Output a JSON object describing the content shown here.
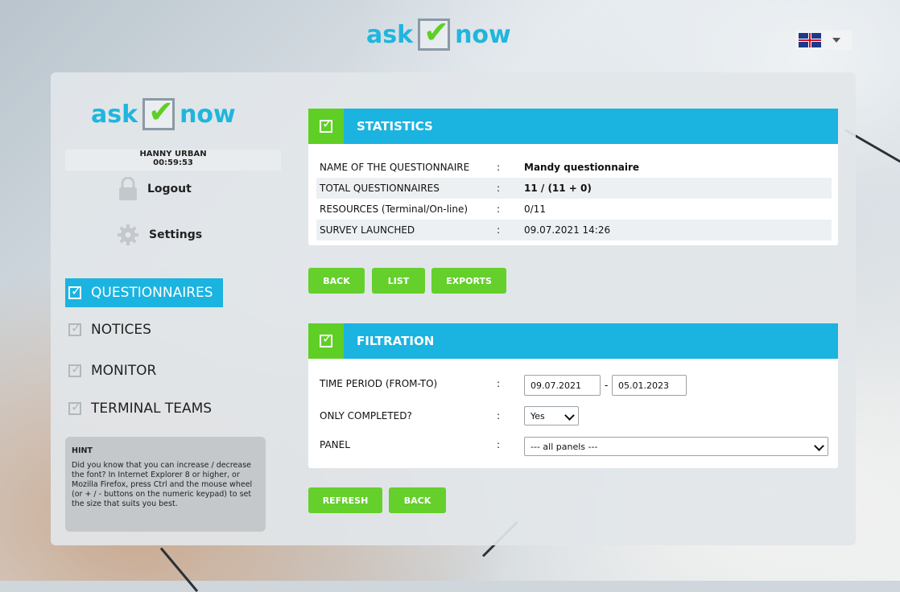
{
  "header": {
    "brand_left": "ask",
    "brand_right": "now",
    "language_icon": "uk-flag-icon"
  },
  "sidebar": {
    "brand_left": "ask",
    "brand_right": "now",
    "user_name": "HANNY URBAN",
    "session_timer": "00:59:53",
    "logout_label": "Logout",
    "settings_label": "Settings",
    "menu": [
      {
        "label": "QUESTIONNAIRES",
        "active": true
      },
      {
        "label": "NOTICES",
        "active": false
      },
      {
        "label": "MONITOR",
        "active": false
      },
      {
        "label": "TERMINAL TEAMS",
        "active": false
      }
    ],
    "hint": {
      "title": "HINT",
      "text": "Did you know that you can increase / decrease the font? In Internet Explorer 8 or higher, or Mozilla Firefox, press Ctrl and the mouse wheel (or + / - buttons on the numeric keypad) to set the size that suits you best."
    }
  },
  "statistics": {
    "title": "STATISTICS",
    "rows": [
      {
        "label": "NAME OF THE QUESTIONNAIRE",
        "value": "Mandy questionnaire"
      },
      {
        "label": "TOTAL QUESTIONNAIRES",
        "value": "11 / (11 + 0)"
      },
      {
        "label": "RESOURCES (Terminal/On-line)",
        "value": "0/11"
      },
      {
        "label": "SURVEY LAUNCHED",
        "value": "09.07.2021 14:26"
      }
    ],
    "separator": ":"
  },
  "actions": {
    "back": "BACK",
    "list": "LIST",
    "exports": "EXPORTS"
  },
  "filtration": {
    "title": "FILTRATION",
    "time_period_label": "TIME PERIOD (FROM-TO)",
    "date_from": "09.07.2021",
    "date_dash": "-",
    "date_to": "05.01.2023",
    "only_completed_label": "ONLY COMPLETED?",
    "only_completed_value": "Yes",
    "panel_label": "PANEL",
    "panel_value": "--- all panels ---",
    "separator": ":"
  },
  "bottom_actions": {
    "refresh": "REFRESH",
    "back": "BACK"
  },
  "colors": {
    "accent_blue": "#1bb3e0",
    "accent_green": "#65cf2c"
  }
}
